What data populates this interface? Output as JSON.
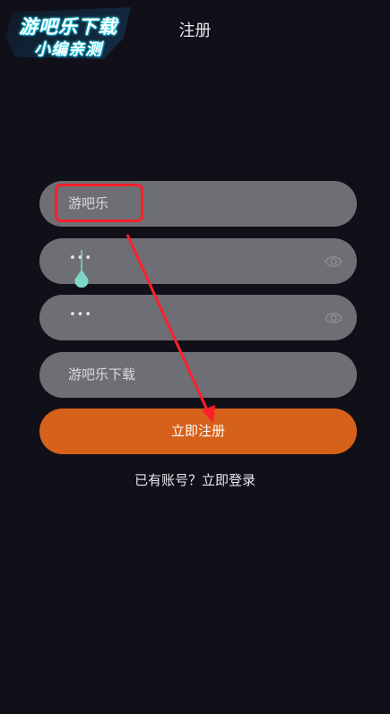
{
  "watermark": {
    "line1": "游吧乐下载",
    "line2": "小编亲测"
  },
  "header": {
    "title": "注册"
  },
  "form": {
    "username": {
      "value": "游吧乐"
    },
    "password": {
      "masked": "•••",
      "eye_icon": "eye-icon"
    },
    "confirm_password": {
      "masked": "•••",
      "eye_icon": "eye-icon"
    },
    "nickname": {
      "value": "游吧乐下载"
    }
  },
  "actions": {
    "register_label": "立即注册",
    "login_prompt": "已有账号？立即登录"
  },
  "colors": {
    "background": "#111019",
    "field": "#6e6e75",
    "primary_button": "#d6611a",
    "annotation": "#ff1f2a",
    "cursor_handle": "#7fd6c8"
  }
}
